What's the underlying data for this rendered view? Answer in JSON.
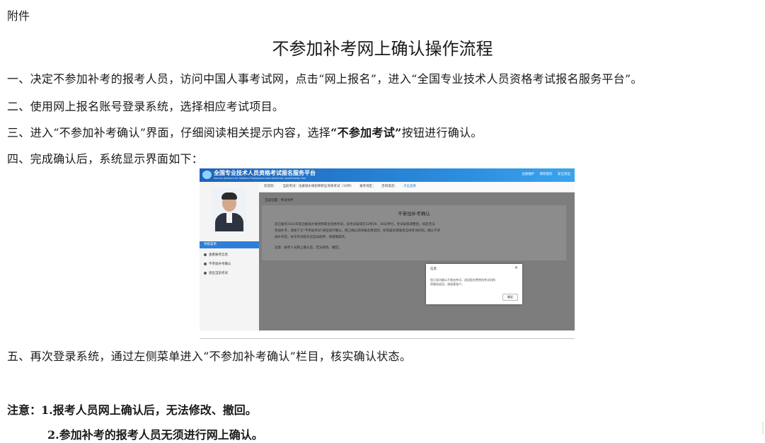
{
  "attachment_label": "附件",
  "title": "不参加补考网上确认操作流程",
  "steps": {
    "s1": "一、决定不参加补考的报考人员，访问中国人事考试网，点击“网上报名”，进入“全国专业技术人员资格考试报名服务平台”。",
    "s2": "二、使用网上报名账号登录系统，选择相应考试项目。",
    "s3_a": "三、进入“不参加补考确认”界面，仔细阅读相关提示内容，选择",
    "s3_b": "“不参加考试”",
    "s3_c": "按钮进行确认。",
    "s4": "四、完成确认后，系统显示界面如下：",
    "s5": "五、再次登录系统，通过左侧菜单进入“不参加补考确认”栏目，核实确认状态。"
  },
  "notes": {
    "n1": "注意：1.报考人员网上确认后，无法修改、撤回。",
    "n2": "2.参加补考的报考人员无须进行网上确认。"
  },
  "screenshot": {
    "platform_title": "全国专业技术人员资格考试报名服务平台",
    "platform_subtitle": "Service platform for National Professional and technician qualification test",
    "top_links": [
      "注册维护",
      "修改密码",
      "安全退出"
    ],
    "topbar": {
      "welcome": "欢迎您：",
      "current_exam": "当前考试：注册城乡规划师职业资格考试（10月）",
      "region": "报考地区：",
      "hotline": "咨询电话：",
      "hotline_link": "点击查看"
    },
    "menu_header": "导航菜单",
    "menu_items": [
      "查看报考信息",
      "不参加补考确认",
      "退出当前考试"
    ],
    "breadcrumb": "当前位置：考试文件",
    "notice_title": "不参加补考确认",
    "notice_lines": [
      "您已报考2022年度注册城乡规划师职业资格考试，该考试安排在10月29、30日举行。考试安排调整后，如您无法",
      "参加补考，请按下方“不参加考试”按钮进行确认。网上确认后将报名费退回，如有疑问请联系当地考试机构。确认不参",
      "加补考后，本次考试视为您自动放弃，请谨慎操作。"
    ],
    "notice_note": "注意：报考人员网上确认后，无法修改、撤回。",
    "dialog_title": "信息",
    "dialog_close": "×",
    "dialog_lines": [
      "您已成功确认不参加考试，退回报名费将由考试机构",
      "原路径返回，请留意账户。"
    ],
    "dialog_button": "确定"
  }
}
